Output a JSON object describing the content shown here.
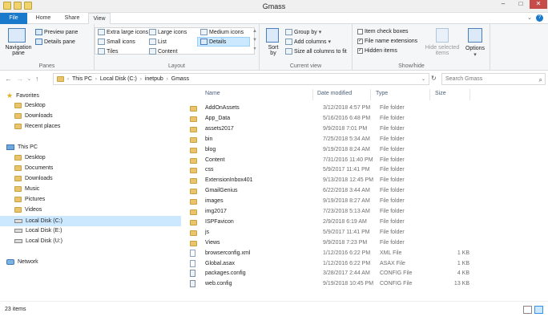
{
  "window": {
    "title": "Gmass"
  },
  "tabs": {
    "file": "File",
    "home": "Home",
    "share": "Share",
    "view": "View"
  },
  "ribbon": {
    "panes": {
      "label": "Panes",
      "navigation_pane": "Navigation",
      "navigation_pane2": "pane",
      "preview_pane": "Preview pane",
      "details_pane": "Details pane"
    },
    "layout": {
      "label": "Layout",
      "extra_large": "Extra large icons",
      "large": "Large icons",
      "medium": "Medium icons",
      "small": "Small icons",
      "list": "List",
      "details": "Details",
      "tiles": "Tiles",
      "content": "Content"
    },
    "current_view": {
      "label": "Current view",
      "sort_by": "Sort",
      "sort_by2": "by",
      "group_by": "Group by",
      "add_columns": "Add columns",
      "size_columns": "Size all columns to fit"
    },
    "show_hide": {
      "label": "Show/hide",
      "item_check_boxes": "Item check boxes",
      "file_name_extensions": "File name extensions",
      "hidden_items": "Hidden items",
      "hide_selected_1": "Hide selected",
      "hide_selected_2": "items",
      "options": "Options"
    }
  },
  "address": {
    "crumbs": [
      "This PC",
      "Local Disk (C:)",
      "inetpub",
      "Gmass"
    ],
    "search_placeholder": "Search Gmass"
  },
  "sidebar": {
    "favorites": "Favorites",
    "fav_items": [
      "Desktop",
      "Downloads",
      "Recent places"
    ],
    "this_pc": "This PC",
    "pc_items": [
      "Desktop",
      "Documents",
      "Downloads",
      "Music",
      "Pictures",
      "Videos"
    ],
    "drives": [
      "Local Disk (C:)",
      "Local Disk (E:)",
      "Local Disk (U:)"
    ],
    "network": "Network"
  },
  "columns": {
    "name": "Name",
    "date": "Date modified",
    "type": "Type",
    "size": "Size"
  },
  "files": [
    {
      "name": "AddOnAssets",
      "date": "3/12/2018 4:57 PM",
      "type": "File folder",
      "size": "",
      "kind": "folder"
    },
    {
      "name": "App_Data",
      "date": "5/16/2016 6:48 PM",
      "type": "File folder",
      "size": "",
      "kind": "folder"
    },
    {
      "name": "assets2017",
      "date": "9/9/2018 7:01 PM",
      "type": "File folder",
      "size": "",
      "kind": "folder"
    },
    {
      "name": "bin",
      "date": "7/25/2018 5:34 AM",
      "type": "File folder",
      "size": "",
      "kind": "folder"
    },
    {
      "name": "blog",
      "date": "9/19/2018 8:24 AM",
      "type": "File folder",
      "size": "",
      "kind": "folder"
    },
    {
      "name": "Content",
      "date": "7/31/2016 11:40 PM",
      "type": "File folder",
      "size": "",
      "kind": "folder"
    },
    {
      "name": "css",
      "date": "5/9/2017 11:41 PM",
      "type": "File folder",
      "size": "",
      "kind": "folder"
    },
    {
      "name": "ExtensionInbox401",
      "date": "9/13/2018 12:45 PM",
      "type": "File folder",
      "size": "",
      "kind": "folder"
    },
    {
      "name": "GmailGenius",
      "date": "6/22/2018 3:44 AM",
      "type": "File folder",
      "size": "",
      "kind": "folder"
    },
    {
      "name": "images",
      "date": "9/19/2018 8:27 AM",
      "type": "File folder",
      "size": "",
      "kind": "folder"
    },
    {
      "name": "img2017",
      "date": "7/23/2018 5:13 AM",
      "type": "File folder",
      "size": "",
      "kind": "folder"
    },
    {
      "name": "ISPFavicon",
      "date": "2/9/2018 6:19 AM",
      "type": "File folder",
      "size": "",
      "kind": "folder"
    },
    {
      "name": "js",
      "date": "5/9/2017 11:41 PM",
      "type": "File folder",
      "size": "",
      "kind": "folder"
    },
    {
      "name": "Views",
      "date": "9/9/2018 7:23 PM",
      "type": "File folder",
      "size": "",
      "kind": "folder"
    },
    {
      "name": "browserconfig.xml",
      "date": "1/12/2016 6:22 PM",
      "type": "XML File",
      "size": "1 KB",
      "kind": "file"
    },
    {
      "name": "Global.asax",
      "date": "1/12/2016 6:22 PM",
      "type": "ASAX File",
      "size": "1 KB",
      "kind": "file"
    },
    {
      "name": "packages.config",
      "date": "3/28/2017 2:44 AM",
      "type": "CONFIG File",
      "size": "4 KB",
      "kind": "file"
    },
    {
      "name": "web.config",
      "date": "9/19/2018 10:45 PM",
      "type": "CONFIG File",
      "size": "13 KB",
      "kind": "file"
    }
  ],
  "status": {
    "count": "23 items"
  }
}
